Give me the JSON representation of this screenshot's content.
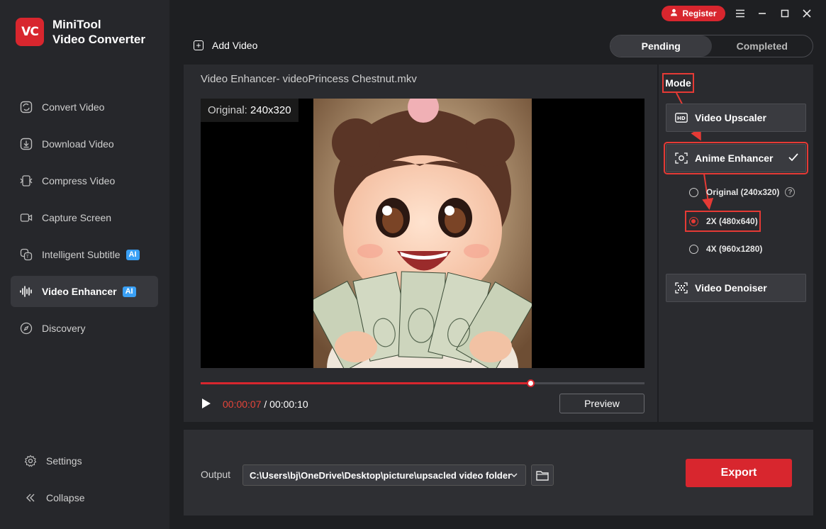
{
  "app": {
    "name_line1": "MiniTool",
    "name_line2": "Video Converter",
    "logo_text": "VC"
  },
  "titlebar": {
    "register_label": "Register"
  },
  "sidebar": {
    "items": [
      {
        "label": "Convert Video",
        "icon": "convert-icon"
      },
      {
        "label": "Download Video",
        "icon": "download-icon"
      },
      {
        "label": "Compress Video",
        "icon": "compress-icon"
      },
      {
        "label": "Capture Screen",
        "icon": "camera-icon"
      },
      {
        "label": "Intelligent Subtitle",
        "icon": "subtitle-icon",
        "badge": "AI"
      },
      {
        "label": "Video Enhancer",
        "icon": "enhancer-icon",
        "badge": "AI",
        "active": true
      },
      {
        "label": "Discovery",
        "icon": "compass-icon"
      }
    ],
    "settings_label": "Settings",
    "collapse_label": "Collapse"
  },
  "toolbar": {
    "add_video_label": "Add Video",
    "tabs": [
      "Pending",
      "Completed"
    ]
  },
  "video": {
    "title": "Video Enhancer- videoPrincess Chestnut.mkv",
    "original_prefix": "Original:",
    "original_res": "240x320",
    "current_time": "00:00:07",
    "separator": "/",
    "total_time": "00:00:10",
    "progress": 0.744,
    "preview_label": "Preview"
  },
  "mode": {
    "label": "Mode",
    "options": [
      "Video Upscaler",
      "Anime Enhancer",
      "Video Denoiser"
    ],
    "selected": "Anime Enhancer",
    "scale_options": [
      "Original (240x320)",
      "2X (480x640)",
      "4X (960x1280)"
    ],
    "selected_scale": "2X (480x640)"
  },
  "output": {
    "label": "Output",
    "path": "C:\\Users\\bj\\OneDrive\\Desktop\\picture\\upsacled video folder",
    "export_label": "Export"
  },
  "colors": {
    "accent": "#d8262e",
    "highlight": "#e53a35",
    "ai_badge": "#3aa0f5"
  }
}
